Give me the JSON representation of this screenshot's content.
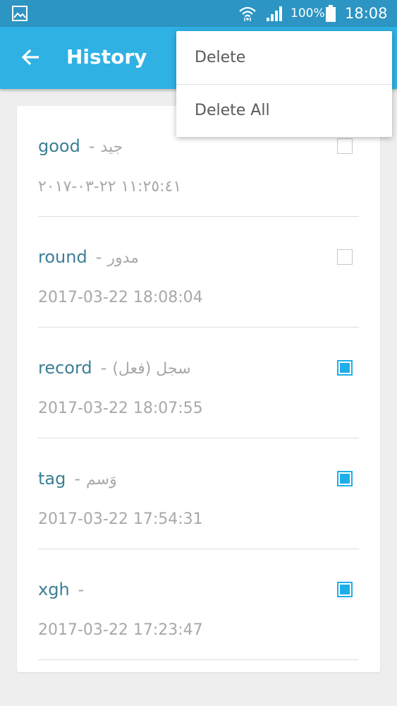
{
  "status_bar": {
    "battery_percent": "100%",
    "time": "18:08",
    "icons": [
      "gallery-icon",
      "wifi-icon",
      "signal-icon",
      "battery-icon"
    ]
  },
  "app_bar": {
    "title": "History",
    "back_icon": "arrow-left-icon"
  },
  "history": {
    "items": [
      {
        "word": "good",
        "dash": "-",
        "translation": "جيد",
        "timestamp": "١١:٢٥:٤١ ٢٢-٠٣-٢٠١٧",
        "checked": false
      },
      {
        "word": "round",
        "dash": "-",
        "translation": "مدور",
        "timestamp": "2017-03-22 18:08:04",
        "checked": false
      },
      {
        "word": "record",
        "dash": "-",
        "translation": "سجل (فعل)",
        "timestamp": "2017-03-22 18:07:55",
        "checked": true
      },
      {
        "word": "tag",
        "dash": "-",
        "translation": "وَسم",
        "timestamp": "2017-03-22 17:54:31",
        "checked": true
      },
      {
        "word": "xgh",
        "dash": "-",
        "translation": "",
        "timestamp": "2017-03-22 17:23:47",
        "checked": true
      }
    ]
  },
  "menu": {
    "delete_label": "Delete",
    "delete_all_label": "Delete All"
  },
  "colors": {
    "status_bar": "#2c95c3",
    "app_bar": "#2fb1e4",
    "word_text": "#3c7f95",
    "secondary_text": "#a8a8a8",
    "checkbox_accent": "#1eaee8"
  }
}
